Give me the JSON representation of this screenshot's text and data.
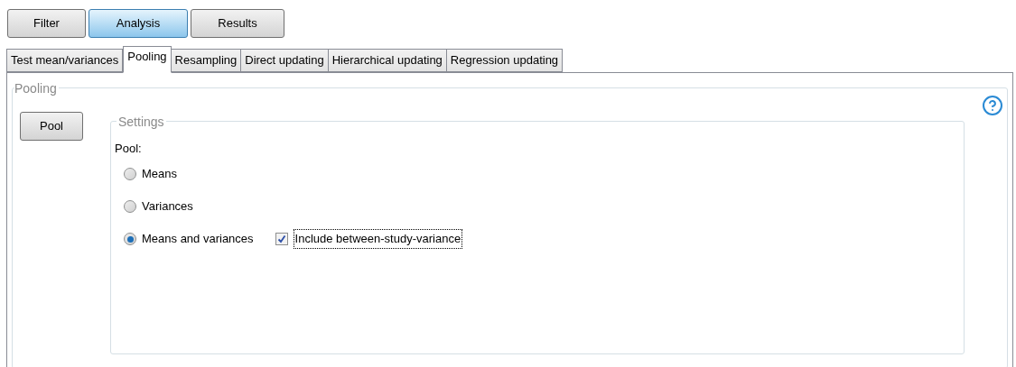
{
  "mode_buttons": [
    {
      "label": "Filter",
      "selected": false
    },
    {
      "label": "Analysis",
      "selected": true
    },
    {
      "label": "Results",
      "selected": false
    }
  ],
  "tabs": [
    {
      "label": "Test mean/variances",
      "selected": false
    },
    {
      "label": "Pooling",
      "selected": true
    },
    {
      "label": "Resampling",
      "selected": false
    },
    {
      "label": "Direct updating",
      "selected": false
    },
    {
      "label": "Hierarchical updating",
      "selected": false
    },
    {
      "label": "Regression updating",
      "selected": false
    }
  ],
  "pooling_group": {
    "title": "Pooling",
    "pool_button": "Pool",
    "settings": {
      "title": "Settings",
      "pool_label": "Pool:",
      "options": [
        {
          "label": "Means",
          "selected": false
        },
        {
          "label": "Variances",
          "selected": false
        },
        {
          "label": "Means and variances",
          "selected": true
        }
      ],
      "include_between_study_variance": {
        "label": "Include between-study-variance",
        "checked": true
      }
    }
  }
}
